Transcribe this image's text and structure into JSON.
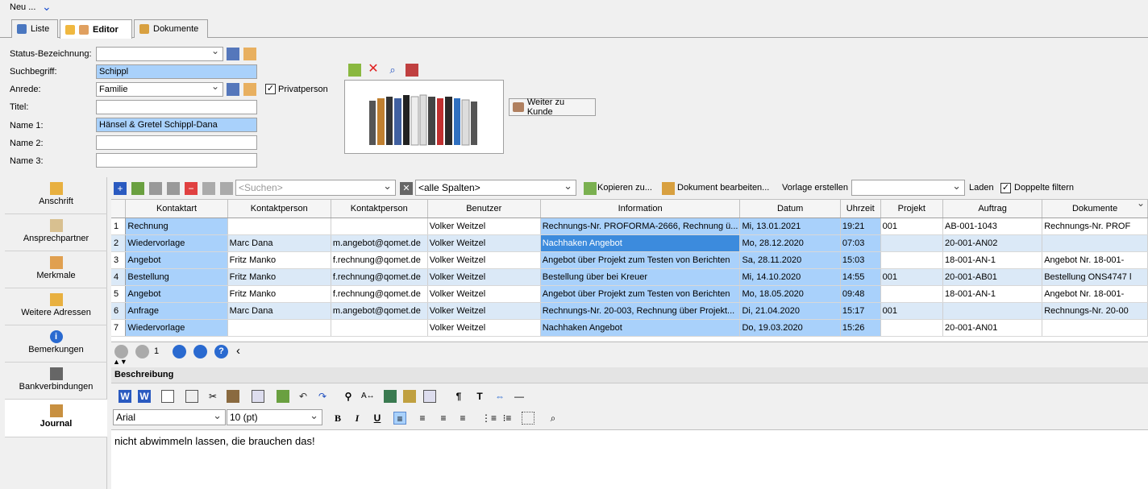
{
  "topbar": {
    "neu_label": "Neu ..."
  },
  "tabs": [
    {
      "label": "Liste"
    },
    {
      "label": "Editor"
    },
    {
      "label": "Dokumente"
    }
  ],
  "form": {
    "status_label": "Status-Bezeichnung:",
    "status_value": "",
    "suchbegriff_label": "Suchbegriff:",
    "suchbegriff_value": "Schippl",
    "anrede_label": "Anrede:",
    "anrede_value": "Familie",
    "privatperson_label": "Privatperson",
    "privatperson_checked": true,
    "titel_label": "Titel:",
    "titel_value": "",
    "name1_label": "Name 1:",
    "name1_value": "Hänsel & Gretel Schippl-Dana",
    "name2_label": "Name 2:",
    "name2_value": "",
    "name3_label": "Name 3:",
    "name3_value": "",
    "weiter_label": "Weiter zu Kunde"
  },
  "leftnav": [
    {
      "label": "Anschrift"
    },
    {
      "label": "Ansprechpartner"
    },
    {
      "label": "Merkmale"
    },
    {
      "label": "Weitere Adressen"
    },
    {
      "label": "Bemerkungen"
    },
    {
      "label": "Bankverbindungen"
    },
    {
      "label": "Journal"
    }
  ],
  "gridtoolbar": {
    "search_placeholder": "<Suchen>",
    "columns_select": "<alle Spalten>",
    "kopieren_label": "Kopieren zu...",
    "dokument_label": "Dokument bearbeiten...",
    "vorlage_label": "Vorlage erstellen",
    "vorlage_value": "",
    "laden_label": "Laden",
    "doppelte_label": "Doppelte filtern"
  },
  "grid": {
    "headers": [
      "Kontaktart",
      "Kontaktperson",
      "Kontaktperson",
      "Benutzer",
      "Information",
      "Datum",
      "Uhrzeit",
      "Projekt",
      "Auftrag",
      "Dokumente"
    ],
    "rows": [
      [
        "1",
        "Rechnung",
        "",
        "",
        "Volker Weitzel",
        "Rechnungs-Nr. PROFORMA-2666, Rechnung ü...",
        "Mi, 13.01.2021",
        "19:21",
        "001",
        "AB-001-1043",
        "Rechnungs-Nr. PROF"
      ],
      [
        "2",
        "Wiedervorlage",
        "Marc Dana",
        "m.angebot@qomet.de",
        "Volker Weitzel",
        "Nachhaken Angebot",
        "Mo, 28.12.2020",
        "07:03",
        "",
        "20-001-AN02",
        ""
      ],
      [
        "3",
        "Angebot",
        "Fritz Manko",
        "f.rechnung@qomet.de",
        "Volker Weitzel",
        "Angebot über Projekt zum Testen von Berichten",
        "Sa, 28.11.2020",
        "15:03",
        "",
        "18-001-AN-1",
        "Angebot Nr. 18-001-"
      ],
      [
        "4",
        "Bestellung",
        "Fritz Manko",
        "f.rechnung@qomet.de",
        "Volker Weitzel",
        "Bestellung über  bei Kreuer",
        "Mi, 14.10.2020",
        "14:55",
        "001",
        "20-001-AB01",
        "Bestellung ONS4747 l"
      ],
      [
        "5",
        "Angebot",
        "Fritz Manko",
        "f.rechnung@qomet.de",
        "Volker Weitzel",
        "Angebot über Projekt zum Testen von Berichten",
        "Mo, 18.05.2020",
        "09:48",
        "",
        "18-001-AN-1",
        "Angebot Nr. 18-001-"
      ],
      [
        "6",
        "Anfrage",
        "Marc Dana",
        "m.angebot@qomet.de",
        "Volker Weitzel",
        "Rechnungs-Nr. 20-003, Rechnung über Projekt...",
        "Di, 21.04.2020",
        "15:17",
        "001",
        "",
        "Rechnungs-Nr. 20-00"
      ],
      [
        "7",
        "Wiedervorlage",
        "",
        "",
        "Volker Weitzel",
        "Nachhaken Angebot",
        "Do, 19.03.2020",
        "15:26",
        "",
        "20-001-AN01",
        ""
      ]
    ]
  },
  "pager": {
    "page": "1"
  },
  "beschreibung": {
    "title": "Beschreibung",
    "font": "Arial",
    "size": "10 (pt)",
    "text": "nicht abwimmeln lassen, die brauchen das!"
  }
}
